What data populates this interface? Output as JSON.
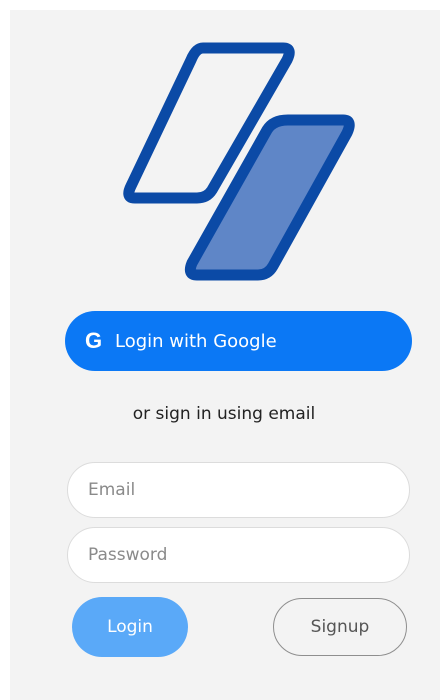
{
  "logo": {
    "icon": "two-parallelograms-logo",
    "outline_color": "#0b4aa6",
    "fill_color": "#5f86c7"
  },
  "google_login": {
    "icon": "G",
    "label": "Login with Google",
    "color": "#0b78f5"
  },
  "divider_text": "or sign in using email",
  "email": {
    "placeholder": "Email",
    "value": ""
  },
  "password": {
    "placeholder": "Password",
    "value": ""
  },
  "actions": {
    "login_label": "Login",
    "login_color": "#5aa9f8",
    "signup_label": "Signup"
  }
}
